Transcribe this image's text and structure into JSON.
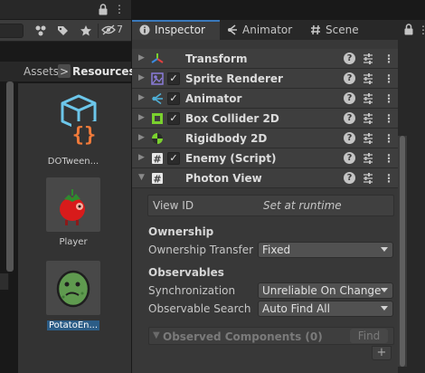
{
  "project_panel": {
    "eye_count": "7",
    "breadcrumb": {
      "root": "Assets",
      "separator": ">",
      "current": "Resources"
    },
    "assets": [
      {
        "name": "DOTween...",
        "icon": "script-object-icon"
      },
      {
        "name": "Player",
        "icon": "tomato-sprite"
      },
      {
        "name": "PotatoEn...",
        "icon": "potato-sprite",
        "selected": true
      }
    ]
  },
  "inspector": {
    "tabs": [
      {
        "label": "Inspector",
        "icon": "info-icon",
        "active": true
      },
      {
        "label": "Animator",
        "icon": "animator-icon"
      },
      {
        "label": "Scene",
        "icon": "scene-icon"
      }
    ],
    "components": [
      {
        "name": "Transform",
        "icon": "transform-icon",
        "checkbox": false,
        "expanded": false
      },
      {
        "name": "Sprite Renderer",
        "icon": "sprite-renderer-icon",
        "checkbox": true,
        "checked": true,
        "expanded": false
      },
      {
        "name": "Animator",
        "icon": "animator-component-icon",
        "checkbox": true,
        "checked": true,
        "expanded": false
      },
      {
        "name": "Box Collider 2D",
        "icon": "box-collider-icon",
        "checkbox": true,
        "checked": true,
        "expanded": false
      },
      {
        "name": "Rigidbody 2D",
        "icon": "rigidbody-icon",
        "checkbox": false,
        "expanded": false
      },
      {
        "name": "Enemy (Script)",
        "icon": "script-icon",
        "checkbox": true,
        "checked": true,
        "expanded": false
      },
      {
        "name": "Photon View",
        "icon": "script-icon",
        "checkbox": false,
        "expanded": true
      }
    ],
    "photon_view": {
      "view_id_label": "View ID",
      "view_id_value": "Set at runtime",
      "ownership_header": "Ownership",
      "ownership_transfer_label": "Ownership Transfer",
      "ownership_transfer_value": "Fixed",
      "observables_header": "Observables",
      "synchronization_label": "Synchronization",
      "synchronization_value": "Unreliable On Change",
      "observable_search_label": "Observable Search",
      "observable_search_value": "Auto Find All",
      "observed_components_label": "Observed Components (0)",
      "find_button": "Find",
      "add_button": "+"
    }
  },
  "colors": {
    "accent": "#3a79bb",
    "selection": "#2c5d87",
    "panel": "#383838",
    "header_row": "#3e3e3e"
  }
}
